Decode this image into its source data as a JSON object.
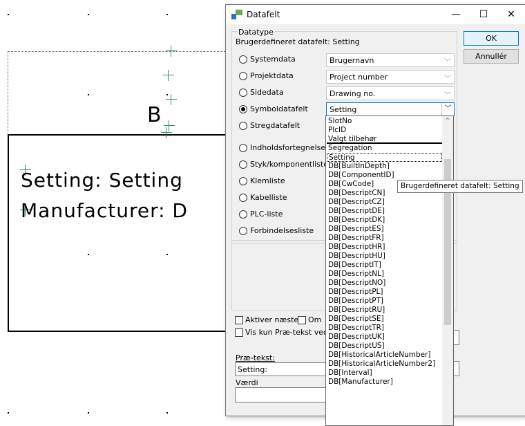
{
  "canvas": {
    "texts": {
      "b_label": "B",
      "setting_line": "Setting: Setting",
      "manufacturer_line": "Manufacturer: D"
    }
  },
  "dialog": {
    "title": "Datafelt",
    "window_buttons": {
      "minimize": "—",
      "maximize": "☐",
      "close": "✕"
    },
    "datatype_group": "Datatype",
    "subtitle": "Brugerdefineret datafelt: Setting",
    "radios": [
      {
        "label": "Systemdata",
        "selected": false,
        "combo": "Brugernavn"
      },
      {
        "label": "Projektdata",
        "selected": false,
        "combo": "Project number"
      },
      {
        "label": "Sidedata",
        "selected": false,
        "combo": "Drawing no."
      },
      {
        "label": "Symboldatafelt",
        "selected": true,
        "combo": "Setting"
      },
      {
        "label": "Stregdatafelt",
        "selected": false
      },
      {
        "label": "Indholdsfortegnelse",
        "selected": false
      },
      {
        "label": "Styk/komponentliste",
        "selected": false
      },
      {
        "label": "Klemliste",
        "selected": false
      },
      {
        "label": "Kabelliste",
        "selected": false
      },
      {
        "label": "PLC-liste",
        "selected": false
      },
      {
        "label": "Forbindelsesliste",
        "selected": false
      }
    ],
    "ok_label": "OK",
    "cancel_label": "Annullér",
    "checkboxes": {
      "activate_next": "Aktiver næste",
      "om": "Om",
      "show_pretext": "Vis kun Præ-tekst ved d"
    },
    "pretext_label": "Præ-tekst:",
    "pretext_value": "Setting:",
    "value_label": "Værdi",
    "value_value": ""
  },
  "dropdown": {
    "items": [
      "SlotNo",
      "PlcID",
      "Valgt tilbehør",
      "Segregation",
      "Setting",
      "DB[BuiltInDepth]",
      "DB[ComponentID]",
      "DB[CwCode]",
      "DB[DescriptCN]",
      "DB[DescriptCZ]",
      "DB[DescriptDE]",
      "DB[DescriptDK]",
      "DB[DescriptES]",
      "DB[DescriptFR]",
      "DB[DescriptHR]",
      "DB[DescriptHU]",
      "DB[DescriptIT]",
      "DB[DescriptNL]",
      "DB[DescriptNO]",
      "DB[DescriptPL]",
      "DB[DescriptPT]",
      "DB[DescriptRU]",
      "DB[DescriptSE]",
      "DB[DescriptTR]",
      "DB[DescriptUK]",
      "DB[DescriptUS]",
      "DB[HistoricalArticleNumber]",
      "DB[HistoricalArticleNumber2]",
      "DB[Interval]",
      "DB[Manufacturer]"
    ],
    "focused_index": 4,
    "tooltip": "Brugerdefineret datafelt: Setting",
    "scroll_up": "^"
  }
}
